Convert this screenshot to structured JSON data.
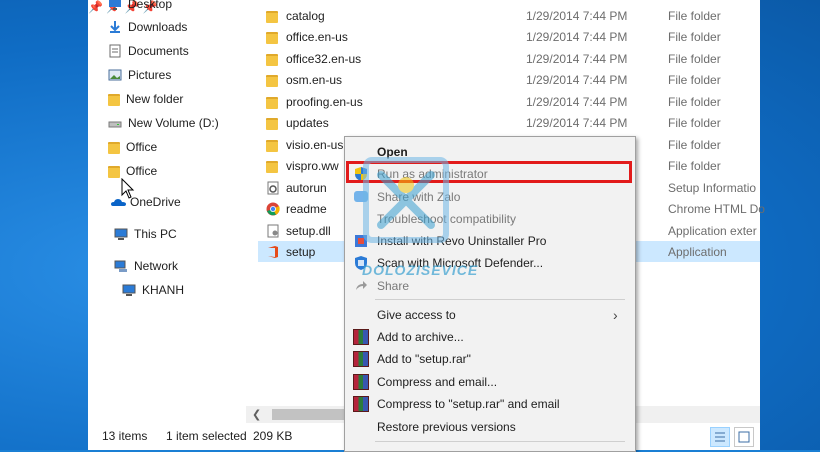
{
  "nav": {
    "items": [
      {
        "label": "Desktop",
        "icon": "desktop-icon",
        "pinned": true
      },
      {
        "label": "Downloads",
        "icon": "downloads-icon",
        "pinned": true
      },
      {
        "label": "Documents",
        "icon": "documents-icon",
        "pinned": true
      },
      {
        "label": "Pictures",
        "icon": "pictures-icon",
        "pinned": true
      },
      {
        "label": "New folder",
        "icon": "folder-icon",
        "pinned": false
      },
      {
        "label": "New Volume (D:)",
        "icon": "drive-icon",
        "pinned": false
      },
      {
        "label": "Office",
        "icon": "folder-icon",
        "pinned": false
      },
      {
        "label": "Office",
        "icon": "folder-icon",
        "pinned": false
      },
      {
        "label": "OneDrive",
        "icon": "onedrive-icon",
        "pinned": false
      },
      {
        "label": "This PC",
        "icon": "computer-icon",
        "pinned": false
      },
      {
        "label": "Network",
        "icon": "network-icon",
        "pinned": false
      },
      {
        "label": "KHANH",
        "icon": "computer-icon",
        "pinned": false
      }
    ]
  },
  "files": [
    {
      "name": "catalog",
      "date": "1/29/2014 7:44 PM",
      "type": "File folder",
      "icon": "folder-icon"
    },
    {
      "name": "office.en-us",
      "date": "1/29/2014 7:44 PM",
      "type": "File folder",
      "icon": "folder-icon"
    },
    {
      "name": "office32.en-us",
      "date": "1/29/2014 7:44 PM",
      "type": "File folder",
      "icon": "folder-icon"
    },
    {
      "name": "osm.en-us",
      "date": "1/29/2014 7:44 PM",
      "type": "File folder",
      "icon": "folder-icon"
    },
    {
      "name": "proofing.en-us",
      "date": "1/29/2014 7:44 PM",
      "type": "File folder",
      "icon": "folder-icon"
    },
    {
      "name": "updates",
      "date": "1/29/2014 7:44 PM",
      "type": "File folder",
      "icon": "folder-icon"
    },
    {
      "name": "visio.en-us",
      "date": "",
      "type": "File folder",
      "icon": "folder-icon"
    },
    {
      "name": "vispro.ww",
      "date": "",
      "type": "File folder",
      "icon": "folder-icon"
    },
    {
      "name": "autorun",
      "date": "",
      "type": "Setup Informatio",
      "icon": "settings-file-icon"
    },
    {
      "name": "readme",
      "date": "",
      "type": "Chrome HTML Do",
      "icon": "chrome-icon"
    },
    {
      "name": "setup.dll",
      "date": "",
      "type": "Application exter",
      "icon": "dll-icon"
    },
    {
      "name": "setup",
      "date": "",
      "type": "Application",
      "icon": "office-icon",
      "selected": true
    }
  ],
  "status": {
    "count": "13 items",
    "selected": "1 item selected",
    "size": "209 KB"
  },
  "context_menu": {
    "items": [
      {
        "label": "Open",
        "bold": true,
        "disabled": false,
        "icon": ""
      },
      {
        "label": "Run as administrator",
        "bold": false,
        "disabled": true,
        "icon": "shield-icon"
      },
      {
        "label": "Share with Zalo",
        "bold": false,
        "disabled": true,
        "icon": "zalo-icon"
      },
      {
        "label": "Troubleshoot compatibility",
        "bold": false,
        "disabled": true,
        "icon": ""
      },
      {
        "label": "Install with Revo Uninstaller Pro",
        "bold": false,
        "disabled": false,
        "icon": "revo-icon"
      },
      {
        "label": "Scan with Microsoft Defender...",
        "bold": false,
        "disabled": false,
        "icon": "defender-icon"
      },
      {
        "label": "Share",
        "bold": false,
        "disabled": true,
        "icon": "share-icon"
      },
      {
        "label": "Give access to",
        "bold": false,
        "disabled": false,
        "icon": "",
        "submenu": true
      },
      {
        "label": "Add to archive...",
        "bold": false,
        "disabled": false,
        "icon": "winrar-icon"
      },
      {
        "label": "Add to \"setup.rar\"",
        "bold": false,
        "disabled": false,
        "icon": "winrar-icon"
      },
      {
        "label": "Compress and email...",
        "bold": false,
        "disabled": false,
        "icon": "winrar-icon"
      },
      {
        "label": "Compress to \"setup.rar\" and email",
        "bold": false,
        "disabled": false,
        "icon": "winrar-icon"
      },
      {
        "label": "Restore previous versions",
        "bold": false,
        "disabled": false,
        "icon": ""
      }
    ]
  },
  "watermark": {
    "text": "DOLOZISEVICE"
  },
  "colors": {
    "selection": "#cce8ff",
    "highlight_box": "#e21b1b",
    "folder": "#f4c542",
    "desktop": "#1a7fd4"
  }
}
